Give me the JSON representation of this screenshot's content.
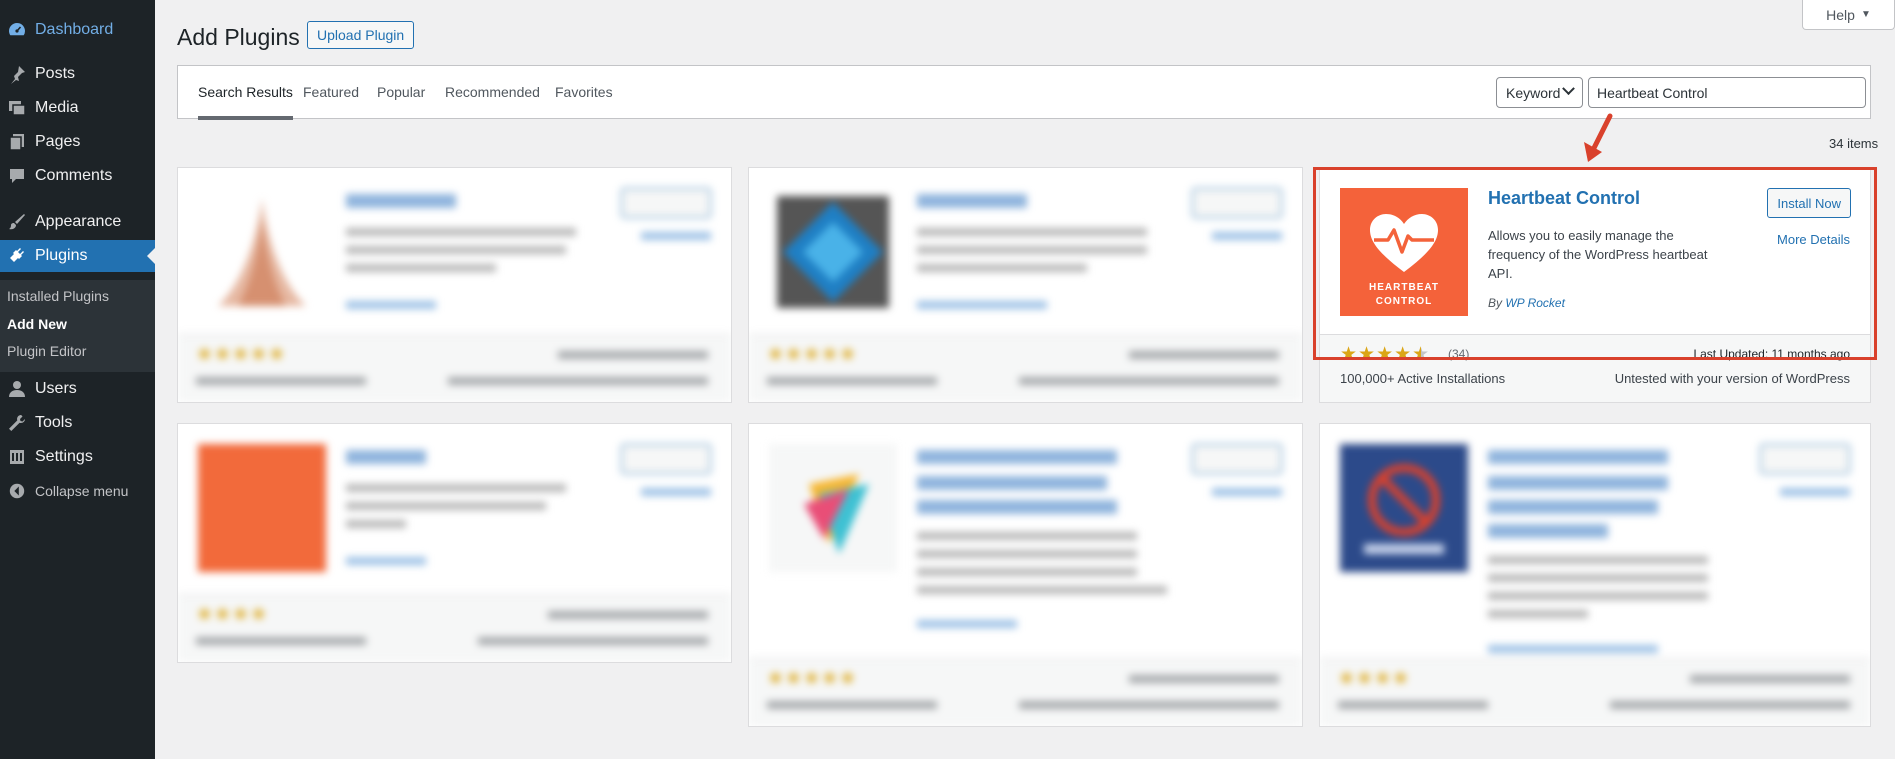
{
  "sidebar": {
    "items": [
      {
        "label": "Dashboard",
        "icon": "dashboard-icon"
      },
      {
        "label": "Posts",
        "icon": "pin-icon"
      },
      {
        "label": "Media",
        "icon": "media-icon"
      },
      {
        "label": "Pages",
        "icon": "pages-icon"
      },
      {
        "label": "Comments",
        "icon": "comment-icon"
      },
      {
        "label": "Appearance",
        "icon": "brush-icon"
      },
      {
        "label": "Plugins",
        "icon": "plug-icon"
      },
      {
        "label": "Users",
        "icon": "user-icon"
      },
      {
        "label": "Tools",
        "icon": "wrench-icon"
      },
      {
        "label": "Settings",
        "icon": "settings-icon"
      }
    ],
    "submenu": [
      "Installed Plugins",
      "Add New",
      "Plugin Editor"
    ],
    "collapse": "Collapse menu"
  },
  "header": {
    "title": "Add Plugins",
    "upload_button": "Upload Plugin",
    "help": "Help"
  },
  "tabs": [
    "Search Results",
    "Featured",
    "Popular",
    "Recommended",
    "Favorites"
  ],
  "search": {
    "type_select": "Keyword",
    "value": "Heartbeat Control"
  },
  "results_count": "34 items",
  "featured_plugin": {
    "name": "Heartbeat Control",
    "logo_text": [
      "HEARTBEAT",
      "CONTROL"
    ],
    "description": "Allows you to easily manage the frequency of the WordPress heartbeat API.",
    "author_prefix": "By",
    "author": "WP Rocket",
    "install_button": "Install Now",
    "more_details": "More Details",
    "rating": 4.5,
    "rating_count": "(34)",
    "last_updated": "Last Updated: 11 months ago",
    "active_installs": "100,000+ Active Installations",
    "compatibility": "Untested with your version of WordPress"
  },
  "colors": {
    "sidebar_bg": "#1d2327",
    "accent": "#2271b1",
    "heartbeat_logo": "#f4623a",
    "highlight_box": "#d9412c",
    "star": "#dba617"
  }
}
